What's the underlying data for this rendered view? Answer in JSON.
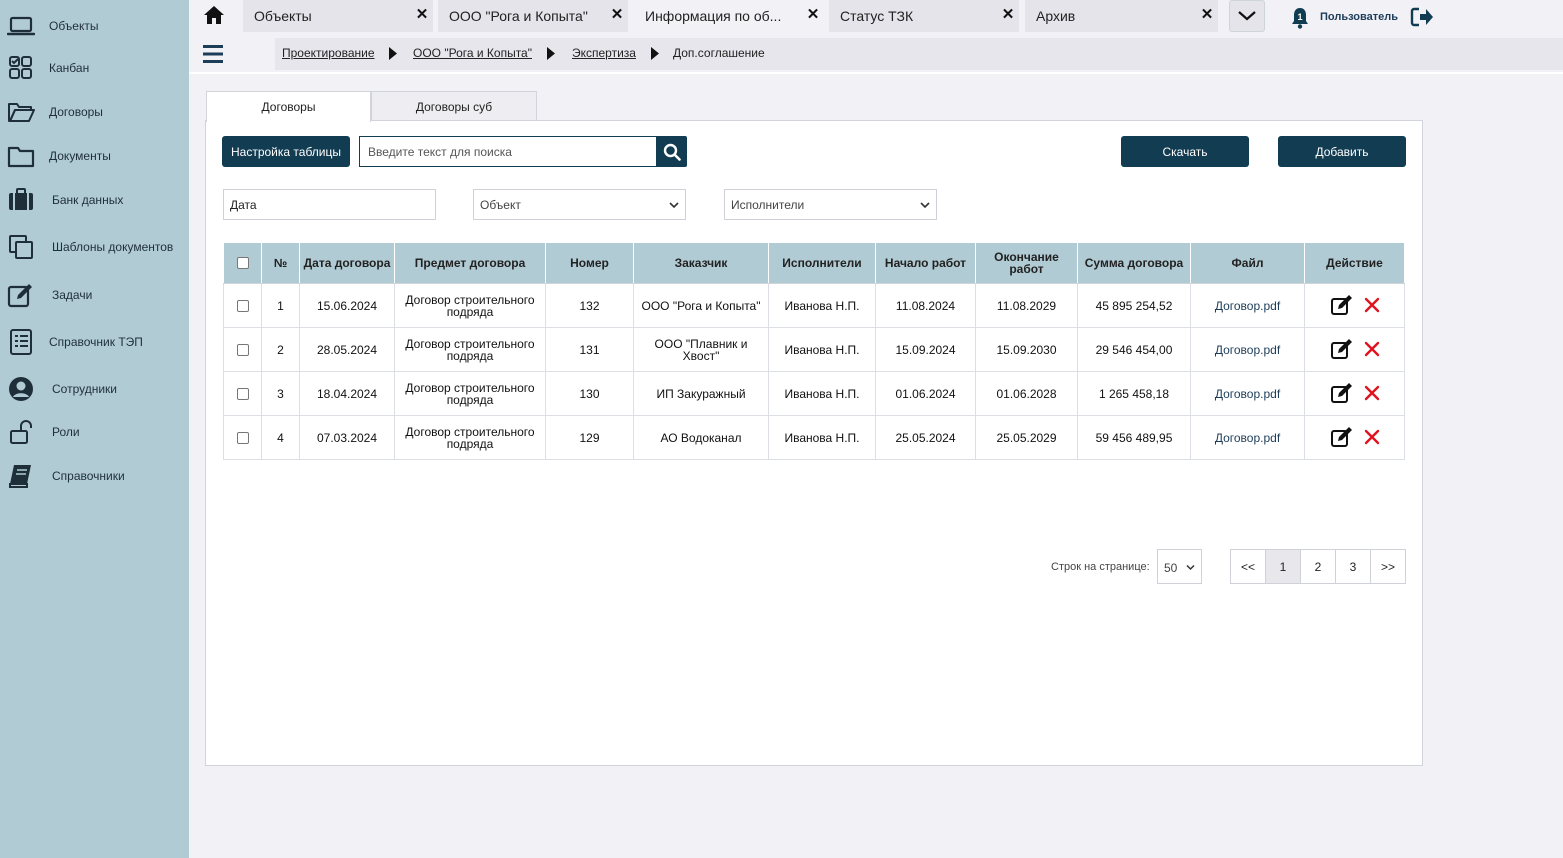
{
  "sidebar": {
    "items": [
      {
        "label": "Объекты",
        "icon": "laptop-icon"
      },
      {
        "label": "Канбан",
        "icon": "kanban-icon"
      },
      {
        "label": "Договоры",
        "icon": "folder-open-icon"
      },
      {
        "label": "Документы",
        "icon": "folder-icon"
      },
      {
        "label": "Банк данных",
        "icon": "briefcase-icon"
      },
      {
        "label": "Шаблоны документов",
        "icon": "copy-icon"
      },
      {
        "label": "Задачи",
        "icon": "edit-icon"
      },
      {
        "label": "Справочник ТЭП",
        "icon": "list-icon"
      },
      {
        "label": "Сотрудники",
        "icon": "user-circle-icon"
      },
      {
        "label": "Роли",
        "icon": "unlock-icon"
      },
      {
        "label": "Справочники",
        "icon": "book-icon"
      }
    ]
  },
  "top_tabs": [
    {
      "title": "Объекты"
    },
    {
      "title": "ООО \"Рога и Копыта\""
    },
    {
      "title": "Информация по об..."
    },
    {
      "title": "Статус ТЗК"
    },
    {
      "title": "Архив"
    }
  ],
  "header": {
    "user_label": "Пользователь",
    "notification_count": "1"
  },
  "breadcrumb": [
    "Проектирование",
    "ООО \"Рога и Копыта\"",
    "Экспертиза",
    "Доп.соглашение"
  ],
  "content_tabs": [
    "Договоры",
    "Договоры суб"
  ],
  "toolbar": {
    "table_settings": "Настройка таблицы",
    "search_placeholder": "Введите текст для поиска",
    "download": "Скачать",
    "add": "Добавить"
  },
  "filters": {
    "date_value": "Дата",
    "object_value": "Объект",
    "executors_value": "Исполнители"
  },
  "table": {
    "headers": [
      "№",
      "Дата договора",
      "Предмет договора",
      "Номер",
      "Заказчик",
      "Исполнители",
      "Начало работ",
      "Окончание работ",
      "Сумма договора",
      "Файл",
      "Действие"
    ],
    "rows": [
      [
        "1",
        "15.06.2024",
        "Договор строительного подряда",
        "132",
        "ООО \"Рога и Копыта\"",
        "Иванова Н.П.",
        "11.08.2024",
        "11.08.2029",
        "45 895 254,52",
        "Договор.pdf"
      ],
      [
        "2",
        "28.05.2024",
        "Договор строительного подряда",
        "131",
        "ООО \"Плавник и Хвост\"",
        "Иванова Н.П.",
        "15.09.2024",
        "15.09.2030",
        "29 546 454,00",
        "Договор.pdf"
      ],
      [
        "3",
        "18.04.2024",
        "Договор строительного подряда",
        "130",
        "ИП Закуражный",
        "Иванова Н.П.",
        "01.06.2024",
        "01.06.2028",
        "1 265 458,18",
        "Договор.pdf"
      ],
      [
        "4",
        "07.03.2024",
        "Договор строительного подряда",
        "129",
        "АО Водоканал",
        "Иванова Н.П.",
        "25.05.2024",
        "25.05.2029",
        "59 456 489,95",
        "Договор.pdf"
      ]
    ]
  },
  "pagination": {
    "rows_label": "Строк на странице:",
    "rows_value": "50",
    "first": "<<",
    "pages": [
      "1",
      "2",
      "3"
    ],
    "last": ">>",
    "current": "1"
  },
  "colors": {
    "sidebar_bg": "#b1cbd4",
    "primary_dark": "#123c52",
    "delete_red": "#e0141e"
  }
}
